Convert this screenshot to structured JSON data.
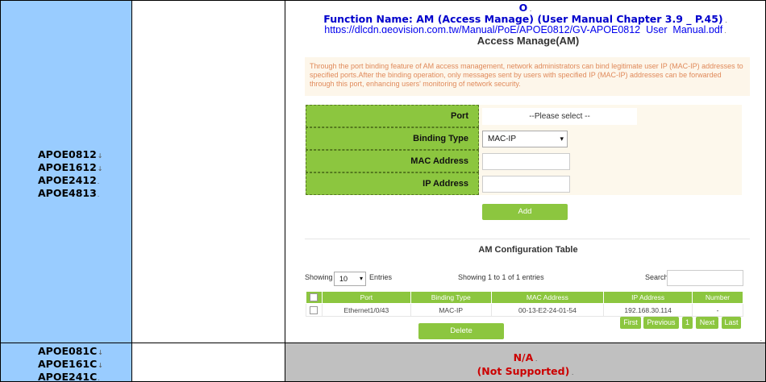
{
  "models_supported": [
    "APOE0812",
    "APOE1612",
    "APOE2412",
    "APOE4813"
  ],
  "models_unsupported": [
    "APOE081C",
    "APOE161C",
    "APOE241C"
  ],
  "header": {
    "marker": "O",
    "function_name": "Function Name: AM (Access Manage) (User Manual Chapter 3.9 _ P.45)",
    "manual_link": "https://dlcdn.geovision.com.tw/Manual/PoE/APOE0812/GV-APOE0812_User_Manual.pdf"
  },
  "screenshot": {
    "title": "Access Manage(AM)",
    "info": "Through the port binding feature of AM access management, network administrators can bind legitimate user IP (MAC-IP) addresses to specified ports.After the binding operation, only messages sent by users with specified IP (MAC-IP) addresses can be forwarded through this port, enhancing users' monitoring of network security.",
    "form": {
      "port_label": "Port",
      "port_value": "--Please select --",
      "binding_label": "Binding Type",
      "binding_value": "MAC-IP",
      "mac_label": "MAC Address",
      "ip_label": "IP Address"
    },
    "add_label": "Add",
    "table_title": "AM Configuration Table",
    "showing_label": "Showing",
    "entries_value": "10",
    "entries_label": "Entries",
    "range_text": "Showing 1 to 1 of 1 entries",
    "search_label": "Search",
    "columns": [
      "Port",
      "Binding Type",
      "MAC Address",
      "IP Address",
      "Number"
    ],
    "rows": [
      {
        "port": "Ethernet1/0/43",
        "binding": "MAC-IP",
        "mac": "00-13-E2-24-01-54",
        "ip": "192.168.30.114",
        "number": "-"
      }
    ],
    "delete_label": "Delete",
    "pager": {
      "first": "First",
      "previous": "Previous",
      "page": "1",
      "next": "Next",
      "last": "Last"
    }
  },
  "na": {
    "line1": "N/A",
    "line2": "(Not Supported)"
  },
  "colors": {
    "models_bg": "#99ccff",
    "accent_green": "#8cc63f",
    "header_blue": "#0000cc",
    "na_red": "#cc0000",
    "na_bg": "#c0c0c0"
  }
}
